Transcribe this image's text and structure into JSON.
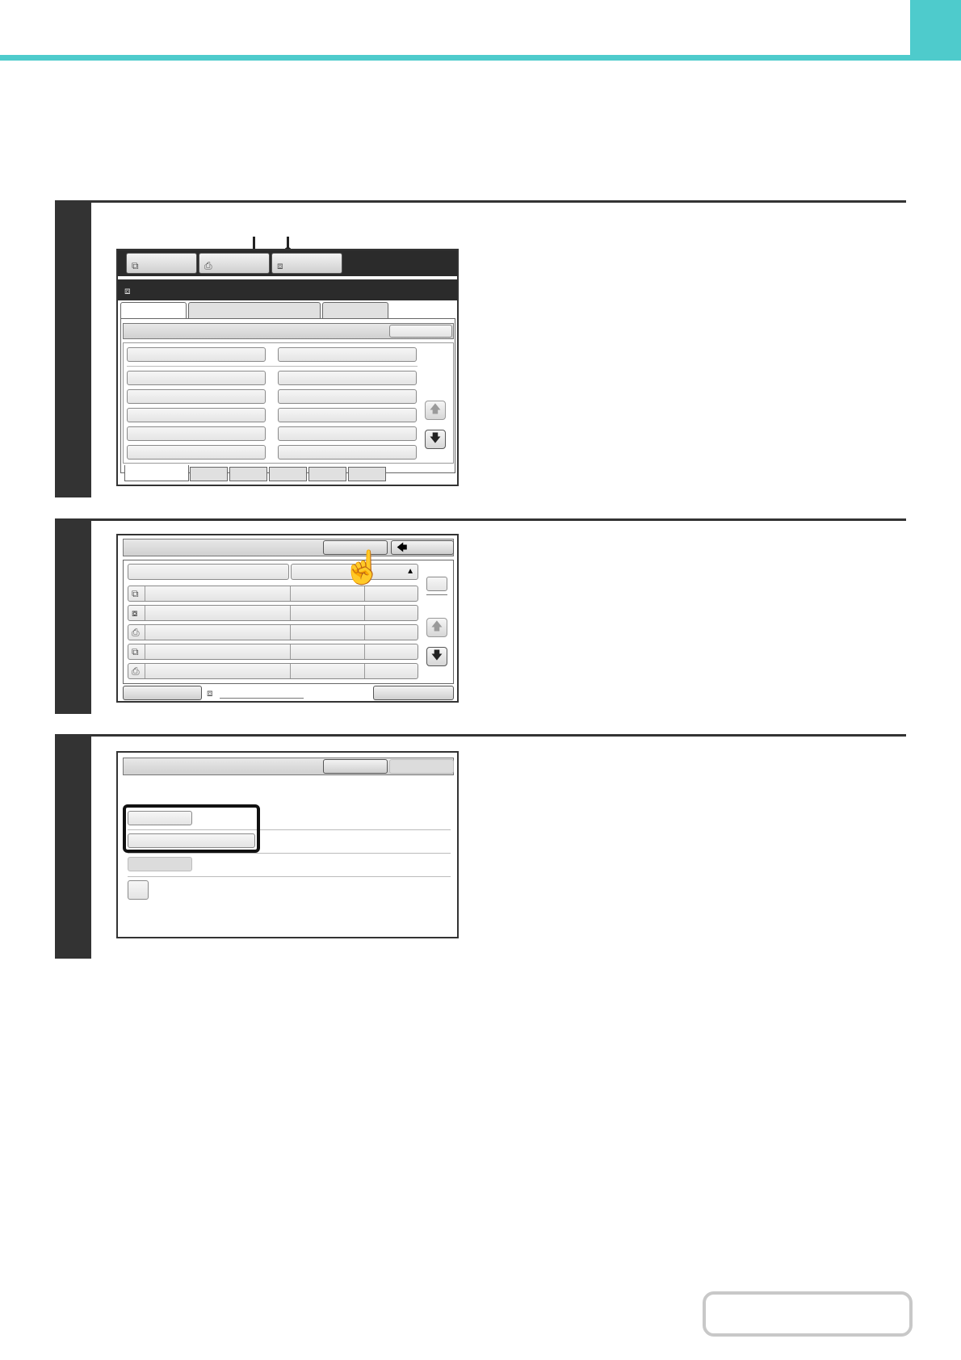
{
  "header": {
    "accent_color": "#4ecbcc"
  },
  "steps": [
    {
      "screen": {
        "mode_tabs": [
          {
            "icon": "copy-icon"
          },
          {
            "icon": "fax-icon"
          },
          {
            "icon": "document-filing-icon",
            "selected": true
          }
        ],
        "title_icon": "document-filing-icon",
        "tabs": 3,
        "folder_buttons": 12,
        "scroll": {
          "up_icon": "arrow-up-icon",
          "down_icon": "arrow-down-icon"
        },
        "index_tabs": 6
      }
    },
    {
      "screen": {
        "back_icon": "arrow-left-icon",
        "sort_icon": "triangle-up-icon",
        "file_rows": [
          {
            "icon": "copy-icon"
          },
          {
            "icon": "scan-icon"
          },
          {
            "icon": "print-icon"
          },
          {
            "icon": "copy-icon"
          },
          {
            "icon": "print-icon"
          }
        ],
        "scroll": {
          "up_icon": "arrow-up-icon",
          "down_icon": "arrow-down-icon"
        },
        "footer_icon": "document-filing-icon"
      }
    },
    {
      "screen": {
        "highlighted_buttons": 2,
        "highlight_color": "#111111"
      }
    }
  ]
}
